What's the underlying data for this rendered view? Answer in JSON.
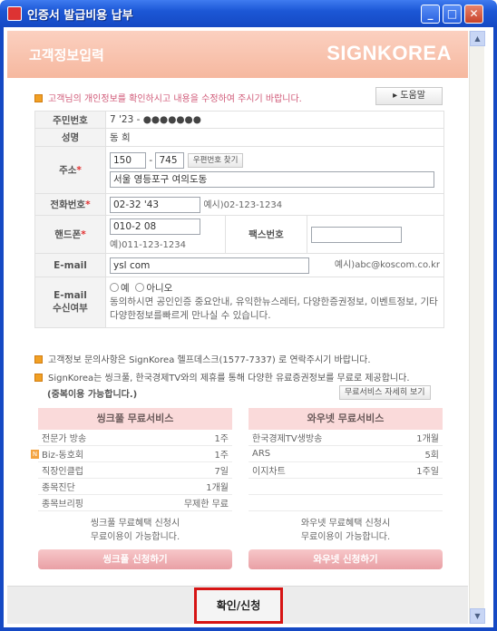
{
  "window": {
    "title": "인증서 발급비용 납부",
    "minimize": "_",
    "maximize": "□",
    "close": "✕"
  },
  "header": {
    "title": "고객정보입력",
    "logo": "SIGNKOREA"
  },
  "notice_top": "고객님의 개인정보를 확인하시고 내용을 수정하여 주시기 바랍니다.",
  "help_button": "도움말",
  "form": {
    "rrn_label": "주민번호",
    "rrn_value": "7   '23 - ●●●●●●●",
    "name_label": "성명",
    "name_value": "동   희",
    "address_label": "주소",
    "zip1": "150",
    "zip_sep": "-",
    "zip2": "745",
    "zip_search": "우편번호 찾기",
    "address1": "서울 영등포구 여의도동",
    "address2": "",
    "phone_label": "전화번호",
    "phone_value": "02-32          '43",
    "phone_hint": "예시)02-123-1234",
    "mobile_label": "핸드폰",
    "mobile_value": "010-2           08",
    "mobile_hint": "예)011-123-1234",
    "fax_label": "팩스번호",
    "fax_value": "",
    "email_label": "E-mail",
    "email_value": "ysl                              com",
    "email_hint": "예시)abc@koscom.co.kr",
    "consent_label1": "E-mail",
    "consent_label2": "수신여부",
    "consent_yes": "예",
    "consent_no": "아니오",
    "consent_desc": "동의하시면 공인인증 중요안내, 유익한뉴스레터, 다양한증권정보, 이벤트정보, 기타다양한정보를빠르게 만나실 수 있습니다."
  },
  "notice_contact": "고객정보 문의사항은 SignKorea 헬프데스크(1577-7337) 로 연락주시기 바랍니다.",
  "notice_partner1": "SignKorea는 씽크풀, 한국경제TV와의 제휴를 통해 다양한 유료증권정보를 무료로 제공합니다.",
  "notice_partner2": "(중복이용 가능합니다.)",
  "free_service_detail": "무료서비스 자세히 보기",
  "thinkpool": {
    "title": "씽크풀 무료서비스",
    "rows": [
      {
        "name": "전문가 방송",
        "value": "1주"
      },
      {
        "name": "Biz-동호회",
        "value": "1주"
      },
      {
        "name": "직장인클럽",
        "value": "7일"
      },
      {
        "name": "종목진단",
        "value": "1개월"
      },
      {
        "name": "종목브리핑",
        "value": "무제한 무료"
      }
    ],
    "foot1": "씽크풀 무료혜택 신청시",
    "foot2": "무료이용이 가능합니다.",
    "button": "씽크풀 신청하기"
  },
  "wownet": {
    "title": "와우넷 무료서비스",
    "rows": [
      {
        "name": "한국경제TV생방송",
        "value": "1개월"
      },
      {
        "name": "ARS",
        "value": "5회"
      },
      {
        "name": "이지차트",
        "value": "1주일"
      },
      {
        "name": "",
        "value": ""
      },
      {
        "name": "",
        "value": ""
      }
    ],
    "foot1": "와우넷 무료혜택 신청시",
    "foot2": "무료이용이 가능합니다.",
    "button": "와우넷 신청하기"
  },
  "confirm_button": "확인/신청"
}
